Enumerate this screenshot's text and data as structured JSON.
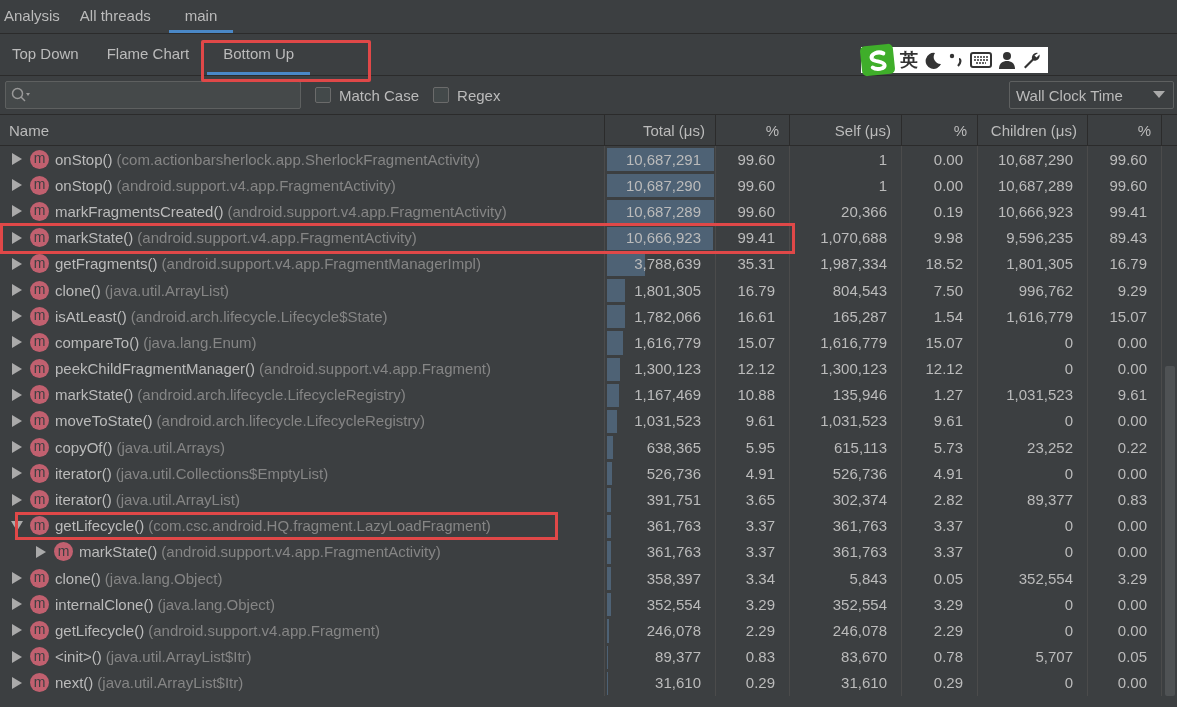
{
  "top_tabs": [
    {
      "label": "Analysis",
      "selected": false
    },
    {
      "label": "All threads",
      "selected": false
    },
    {
      "label": "main",
      "selected": true
    }
  ],
  "view_tabs": [
    {
      "label": "Top Down",
      "selected": false,
      "annotated": false
    },
    {
      "label": "Flame Chart",
      "selected": false,
      "annotated": false
    },
    {
      "label": "Bottom Up",
      "selected": true,
      "annotated": true
    }
  ],
  "ime_bar": {
    "mode": "英"
  },
  "filter": {
    "match_case": {
      "label": "Match Case",
      "checked": false
    },
    "regex": {
      "label": "Regex",
      "checked": false
    },
    "clock": "Wall Clock Time"
  },
  "table": {
    "columns": [
      "Name",
      "Total (μs)",
      "%",
      "Self (μs)",
      "%",
      "Children (μs)",
      "%"
    ],
    "rows": [
      {
        "method": "onStop()",
        "class": "(com.actionbarsherlock.app.SherlockFragmentActivity)",
        "badge": "m",
        "expanded": false,
        "annotated": false,
        "level": 0.996,
        "total": "10,687,291",
        "total_pct": "99.60",
        "self": "1",
        "self_pct": "0.00",
        "children_us": "10,687,290",
        "children_pct": "99.60"
      },
      {
        "method": "onStop()",
        "class": "(android.support.v4.app.FragmentActivity)",
        "badge": "m",
        "expanded": false,
        "annotated": false,
        "level": 0.996,
        "total": "10,687,290",
        "total_pct": "99.60",
        "self": "1",
        "self_pct": "0.00",
        "children_us": "10,687,289",
        "children_pct": "99.60"
      },
      {
        "method": "markFragmentsCreated()",
        "class": "(android.support.v4.app.FragmentActivity)",
        "badge": "m",
        "expanded": false,
        "annotated": false,
        "level": 0.996,
        "total": "10,687,289",
        "total_pct": "99.60",
        "self": "20,366",
        "self_pct": "0.19",
        "children_us": "10,666,923",
        "children_pct": "99.41"
      },
      {
        "method": "markState()",
        "class": "(android.support.v4.app.FragmentActivity)",
        "badge": "m",
        "expanded": false,
        "annotated": true,
        "level": 0.9941,
        "total": "10,666,923",
        "total_pct": "99.41",
        "self": "1,070,688",
        "self_pct": "9.98",
        "children_us": "9,596,235",
        "children_pct": "89.43"
      },
      {
        "method": "getFragments()",
        "class": "(android.support.v4.app.FragmentManagerImpl)",
        "badge": "m",
        "expanded": false,
        "annotated": false,
        "level": 0.3531,
        "total": "3,788,639",
        "total_pct": "35.31",
        "self": "1,987,334",
        "self_pct": "18.52",
        "children_us": "1,801,305",
        "children_pct": "16.79"
      },
      {
        "method": "clone()",
        "class": "(java.util.ArrayList)",
        "badge": "m",
        "expanded": false,
        "annotated": false,
        "level": 0.1679,
        "total": "1,801,305",
        "total_pct": "16.79",
        "self": "804,543",
        "self_pct": "7.50",
        "children_us": "996,762",
        "children_pct": "9.29"
      },
      {
        "method": "isAtLeast()",
        "class": "(android.arch.lifecycle.Lifecycle$State)",
        "badge": "m",
        "expanded": false,
        "annotated": false,
        "level": 0.1661,
        "total": "1,782,066",
        "total_pct": "16.61",
        "self": "165,287",
        "self_pct": "1.54",
        "children_us": "1,616,779",
        "children_pct": "15.07"
      },
      {
        "method": "compareTo()",
        "class": "(java.lang.Enum)",
        "badge": "m",
        "expanded": false,
        "annotated": false,
        "level": 0.1507,
        "total": "1,616,779",
        "total_pct": "15.07",
        "self": "1,616,779",
        "self_pct": "15.07",
        "children_us": "0",
        "children_pct": "0.00"
      },
      {
        "method": "peekChildFragmentManager()",
        "class": "(android.support.v4.app.Fragment)",
        "badge": "m",
        "expanded": false,
        "annotated": false,
        "level": 0.1212,
        "total": "1,300,123",
        "total_pct": "12.12",
        "self": "1,300,123",
        "self_pct": "12.12",
        "children_us": "0",
        "children_pct": "0.00"
      },
      {
        "method": "markState()",
        "class": "(android.arch.lifecycle.LifecycleRegistry)",
        "badge": "m",
        "expanded": false,
        "annotated": false,
        "level": 0.1088,
        "total": "1,167,469",
        "total_pct": "10.88",
        "self": "135,946",
        "self_pct": "1.27",
        "children_us": "1,031,523",
        "children_pct": "9.61"
      },
      {
        "method": "moveToState()",
        "class": "(android.arch.lifecycle.LifecycleRegistry)",
        "badge": "m",
        "expanded": false,
        "annotated": false,
        "level": 0.0961,
        "total": "1,031,523",
        "total_pct": "9.61",
        "self": "1,031,523",
        "self_pct": "9.61",
        "children_us": "0",
        "children_pct": "0.00"
      },
      {
        "method": "copyOf()",
        "class": "(java.util.Arrays)",
        "badge": "m",
        "expanded": false,
        "annotated": false,
        "level": 0.0595,
        "total": "638,365",
        "total_pct": "5.95",
        "self": "615,113",
        "self_pct": "5.73",
        "children_us": "23,252",
        "children_pct": "0.22"
      },
      {
        "method": "iterator()",
        "class": "(java.util.Collections$EmptyList)",
        "badge": "m",
        "expanded": false,
        "annotated": false,
        "level": 0.0491,
        "total": "526,736",
        "total_pct": "4.91",
        "self": "526,736",
        "self_pct": "4.91",
        "children_us": "0",
        "children_pct": "0.00"
      },
      {
        "method": "iterator()",
        "class": "(java.util.ArrayList)",
        "badge": "m",
        "expanded": false,
        "annotated": false,
        "level": 0.0365,
        "total": "391,751",
        "total_pct": "3.65",
        "self": "302,374",
        "self_pct": "2.82",
        "children_us": "89,377",
        "children_pct": "0.83"
      },
      {
        "method": "getLifecycle()",
        "class": "(com.csc.android.HQ.fragment.LazyLoadFragment)",
        "badge": "m",
        "expanded": true,
        "annotated": true,
        "level": 0.0337,
        "total": "361,763",
        "total_pct": "3.37",
        "self": "361,763",
        "self_pct": "3.37",
        "children_us": "0",
        "children_pct": "0.00",
        "children": [
          {
            "method": "markState()",
            "class": "(android.support.v4.app.FragmentActivity)",
            "badge": "m",
            "expanded": false,
            "annotated": false,
            "level": 0.0337,
            "total": "361,763",
            "total_pct": "3.37",
            "self": "361,763",
            "self_pct": "3.37",
            "children_us": "0",
            "children_pct": "0.00"
          }
        ]
      },
      {
        "method": "clone()",
        "class": "(java.lang.Object)",
        "badge": "m",
        "expanded": false,
        "annotated": false,
        "level": 0.0334,
        "total": "358,397",
        "total_pct": "3.34",
        "self": "5,843",
        "self_pct": "0.05",
        "children_us": "352,554",
        "children_pct": "3.29"
      },
      {
        "method": "internalClone()",
        "class": "(java.lang.Object)",
        "badge": "m",
        "expanded": false,
        "annotated": false,
        "level": 0.0329,
        "total": "352,554",
        "total_pct": "3.29",
        "self": "352,554",
        "self_pct": "3.29",
        "children_us": "0",
        "children_pct": "0.00"
      },
      {
        "method": "getLifecycle()",
        "class": "(android.support.v4.app.Fragment)",
        "badge": "m",
        "expanded": false,
        "annotated": false,
        "level": 0.0229,
        "total": "246,078",
        "total_pct": "2.29",
        "self": "246,078",
        "self_pct": "2.29",
        "children_us": "0",
        "children_pct": "0.00"
      },
      {
        "method": "<init>()",
        "class": "(java.util.ArrayList$Itr)",
        "badge": "m",
        "expanded": false,
        "annotated": false,
        "level": 0.0083,
        "total": "89,377",
        "total_pct": "0.83",
        "self": "83,670",
        "self_pct": "0.78",
        "children_us": "5,707",
        "children_pct": "0.05"
      },
      {
        "method": "next()",
        "class": "(java.util.ArrayList$Itr)",
        "badge": "m",
        "expanded": false,
        "annotated": false,
        "level": 0.0029,
        "total": "31,610",
        "total_pct": "0.29",
        "self": "31,610",
        "self_pct": "0.29",
        "children_us": "0",
        "children_pct": "0.00"
      }
    ]
  }
}
